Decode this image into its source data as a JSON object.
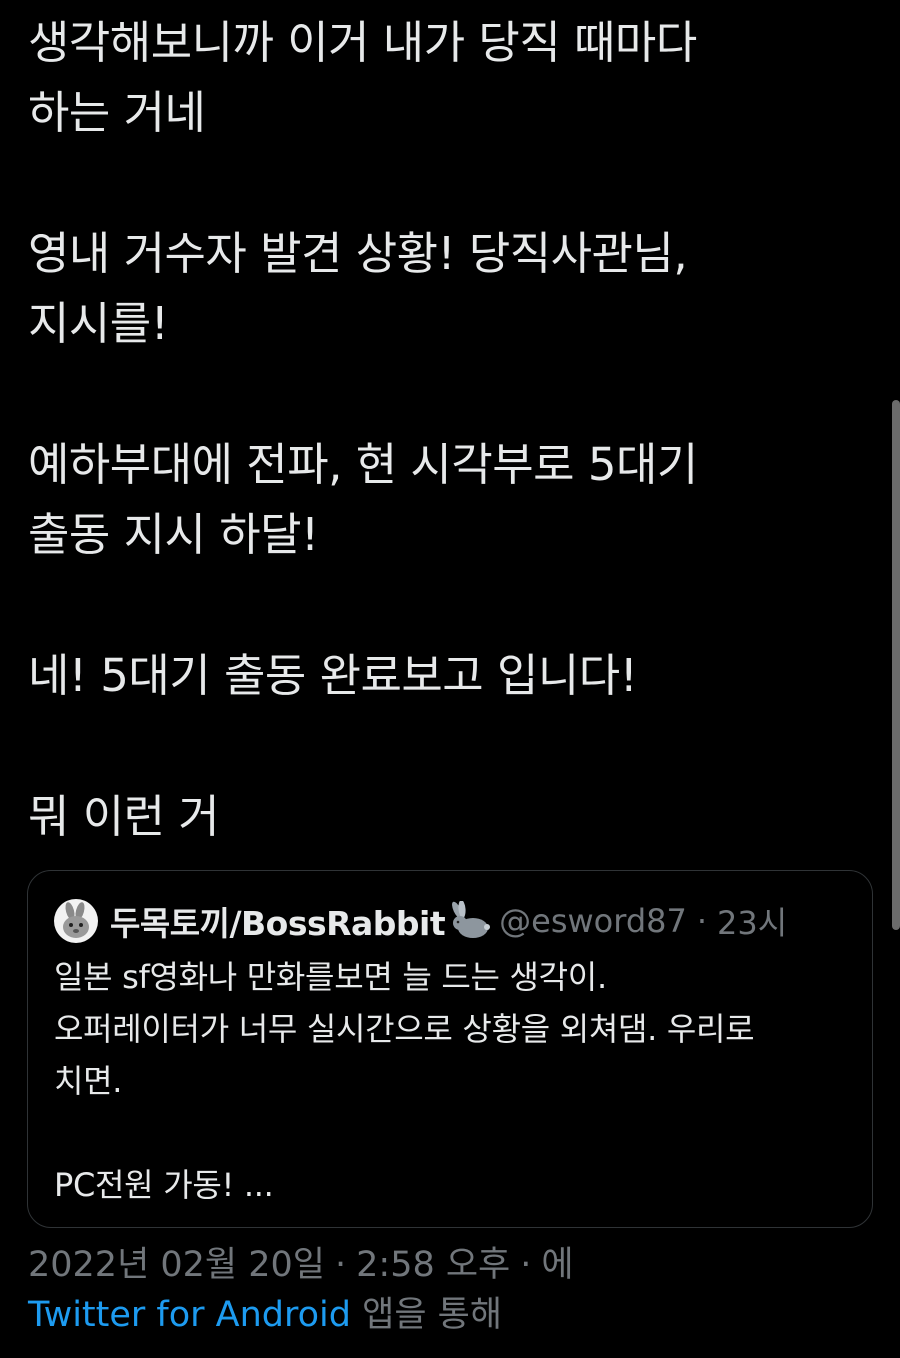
{
  "tweet": {
    "lines": [
      "생각해보니까 이거 내가 당직 때마다",
      "하는 거네",
      "",
      "영내 거수자 발견 상황! 당직사관님,",
      "지시를!",
      "",
      "예하부대에 전파, 현 시각부로 5대기",
      "출동 지시 하달!",
      "",
      "네! 5대기 출동 완료보고 입니다!",
      "",
      "뭐 이런 거"
    ]
  },
  "quote": {
    "name": "두목토끼/BossRabbit",
    "name_emoji": "rabbit-emoji",
    "handle": "@esword87",
    "separator": "·",
    "time": "23시",
    "avatar_icon": "rabbit-avatar-icon",
    "lines": [
      "일본 sf영화나 만화를보면 늘 드는 생각이.",
      "오퍼레이터가 너무 실시간으로 상황을 외쳐댐. 우리로",
      "치면.",
      "",
      "PC전원 가동! ..."
    ]
  },
  "meta": {
    "date": "2022년 02월 20일",
    "separator": "·",
    "time": "2:58 오후",
    "via_prefix": "에",
    "source": "Twitter for Android",
    "source_suffix": "앱을 통해"
  },
  "colors": {
    "background": "#000000",
    "text": "#e7e9ea",
    "muted": "#71767b",
    "link": "#1d9bf0",
    "border": "#2f3336"
  }
}
